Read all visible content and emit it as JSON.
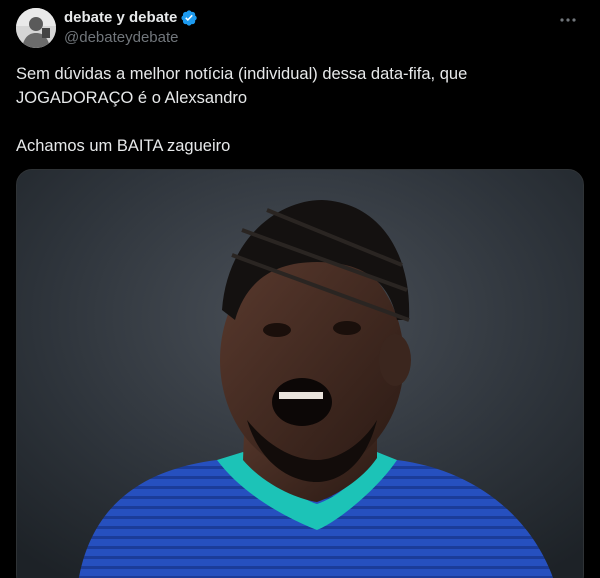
{
  "author": {
    "display_name": "debate y debate",
    "handle": "@debateydebate",
    "verified": true
  },
  "tweet": {
    "line1": "Sem dúvidas a melhor notícia (individual) dessa data-fifa, que",
    "line2": "JOGADORAÇO é o Alexsandro",
    "line3": "Achamos um BAITA zagueiro"
  },
  "icons": {
    "more": "more-horizontal-icon",
    "verified": "verified-badge-icon"
  },
  "colors": {
    "background": "#000000",
    "text": "#e7e9ea",
    "secondary_text": "#71767b",
    "verified_blue": "#1d9bf0",
    "jersey_blue": "#2a55c4",
    "collar_teal": "#1cc3b7"
  }
}
